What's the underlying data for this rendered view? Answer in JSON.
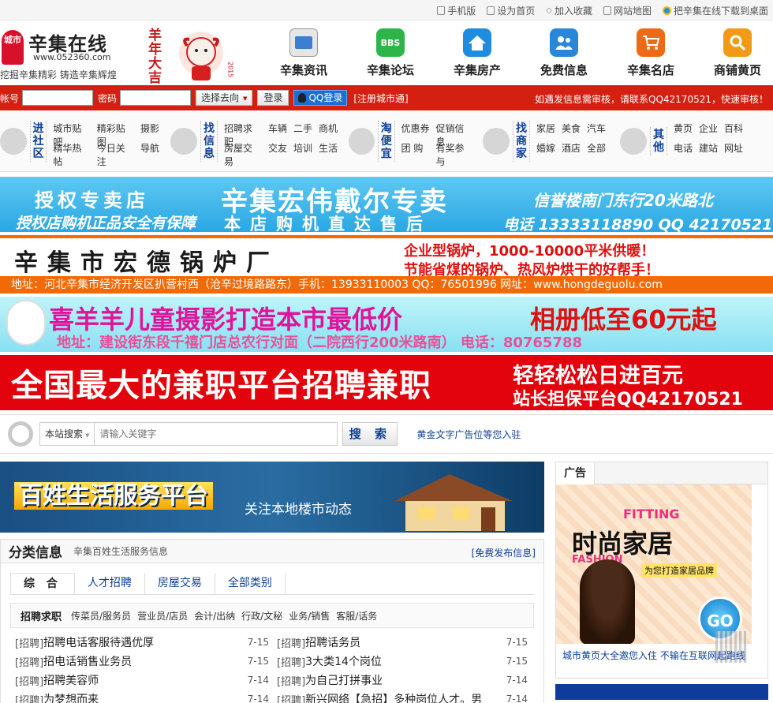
{
  "topbar": {
    "links": [
      {
        "label": "手机版",
        "icon": "phone-icon"
      },
      {
        "label": "设为首页",
        "icon": "home-icon"
      },
      {
        "label": "加入收藏",
        "icon": "star-icon"
      },
      {
        "label": "网站地图",
        "icon": "map-icon"
      },
      {
        "label": "把辛集在线下载到桌面",
        "icon": "ie-icon"
      }
    ]
  },
  "header": {
    "logo_badge": "城市",
    "site_name": "辛集在线",
    "site_url": "www.052360.com",
    "slogan": "挖掘辛集精彩 铸造辛集辉煌",
    "nav": [
      {
        "label": "辛集资讯",
        "color": "#3a7fd0",
        "icon": "news-icon"
      },
      {
        "label": "辛集论坛",
        "color": "#2db54a",
        "icon": "bbs-icon"
      },
      {
        "label": "辛集房产",
        "color": "#1e8de0",
        "icon": "house-icon"
      },
      {
        "label": "免费信息",
        "color": "#2a86d8",
        "icon": "people-icon"
      },
      {
        "label": "辛集名店",
        "color": "#ef6a14",
        "icon": "cart-icon"
      },
      {
        "label": "商铺黄页",
        "color": "#f29a16",
        "icon": "magnifier-icon"
      }
    ],
    "nav_bbs": "BBS",
    "newyear_text": "羊年大吉",
    "newyear_year": "2015"
  },
  "login": {
    "account_label": "帐号",
    "password_label": "密码",
    "select_label": "选择去向",
    "login_button": "登录",
    "qq_button": "QQ登录",
    "register": "[注册城市通]",
    "notice": "如遇发信息需审核，请联系QQ42170521，快速审核！"
  },
  "catnav": [
    {
      "title": "进社区",
      "icon": "chat-icon",
      "links": [
        "城市贴吧",
        "精华热帖",
        "精彩贴图",
        "今日关注",
        "摄影",
        "导航"
      ]
    },
    {
      "title": "找信息",
      "icon": "teacup-icon",
      "links": [
        "招聘求职",
        "房屋交易",
        "车辆",
        "交友",
        "二手",
        "培训",
        "商机",
        "生活"
      ]
    },
    {
      "title": "淘便宜",
      "icon": "cart-icon",
      "links": [
        "优惠券",
        "团 购",
        "促销信息",
        "有奖参与"
      ]
    },
    {
      "title": "找商家",
      "icon": "location-icon",
      "links": [
        "家居",
        "婚嫁",
        "美食",
        "酒店",
        "汽车",
        "全部"
      ]
    },
    {
      "title": "其他",
      "icon": "newspaper-icon",
      "links": [
        "黄页",
        "电话",
        "企业",
        "建站",
        "百科",
        "网址"
      ]
    }
  ],
  "banners": {
    "b1": {
      "left_top": "授权专卖店",
      "center": "辛集宏伟戴尔专卖",
      "right": "信誉楼南门东行20米路北",
      "bottom_left": "授权店购机正品安全有保障",
      "bottom_mid": "本店购机直达售后",
      "phone": "电话 13333118890 QQ 42170521"
    },
    "b2": {
      "name": "辛集市宏德锅炉厂",
      "line1": "企业型锅炉，1000-10000平米供暖！",
      "line2": "节能省煤的锅炉、热风炉烘干的好帮手！",
      "address": "地址：河北辛集市经济开发区扒营村西（沧辛过境路路东）手机：13933110003  QQ：76501996  网址：www.hongdeguolu.com"
    },
    "b3": {
      "title": "喜羊羊儿童摄影打造本市最低价",
      "price": "相册低至60元起",
      "address": "地址：建设街东段千禧门店总农行对面（二院西行200米路南）  电话：80765788"
    },
    "b4": {
      "title": "全国最大的兼职平台招聘兼职",
      "right_top": "轻轻松松日进百元",
      "right_bottom": "站长担保平台QQ42170521"
    }
  },
  "search": {
    "scope": "本站搜索",
    "placeholder": "请输入关键字",
    "button": "搜 索",
    "gold_text": "黄金文字广告位等您入驻"
  },
  "platform": {
    "title": "百姓生活服务平台",
    "subtitle": "关注本地楼市动态"
  },
  "classified": {
    "title": "分类信息",
    "subtitle": "辛集百姓生活服务信息",
    "post_link": "[免费发布信息]",
    "tabs": [
      "综 合",
      "人才招聘",
      "房屋交易",
      "全部类别"
    ],
    "sub_header": "招聘求职",
    "sub_links": [
      "传菜员/服务员",
      "营业员/店员",
      "会计/出纳",
      "行政/文秘",
      "业务/销售",
      "客服/话务"
    ],
    "jobs": [
      {
        "tag": "[招聘]",
        "title": "招聘电话客服待遇优厚",
        "date": "7-15"
      },
      {
        "tag": "[招聘]",
        "title": "招聘话务员",
        "date": "7-15"
      },
      {
        "tag": "[招聘]",
        "title": "招电话销售业务员",
        "date": "7-15"
      },
      {
        "tag": "[招聘]",
        "title": "3大类14个岗位",
        "date": "7-15"
      },
      {
        "tag": "[招聘]",
        "title": "招聘美容师",
        "date": "7-14"
      },
      {
        "tag": "[招聘]",
        "title": "为自己打拼事业",
        "date": "7-14"
      },
      {
        "tag": "[招聘]",
        "title": "为梦想而来",
        "date": "7-14"
      },
      {
        "tag": "[招聘]",
        "title": "新兴网络【急招】多种岗位人才。男",
        "date": "7-14"
      }
    ]
  },
  "ad": {
    "header": "广告",
    "fitting": "FITTING",
    "fashion_cn": "时尚家居",
    "fashion_en": "FASHION",
    "slogan": "为您打造家居品牌",
    "go": "GO",
    "footer": "城市黄页大全邀您入住 不输在互联网起跑线"
  }
}
